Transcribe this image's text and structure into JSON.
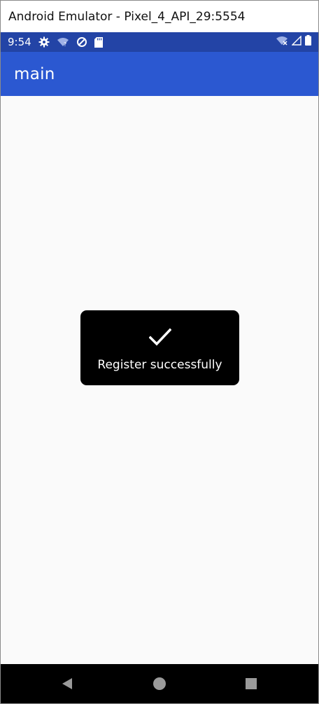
{
  "window": {
    "title": "Android Emulator - Pixel_4_API_29:5554"
  },
  "status_bar": {
    "time": "9:54",
    "left_icons": [
      "gear-icon",
      "wifi-question-icon",
      "data-saver-icon",
      "sd-card-icon"
    ],
    "right_icons": [
      "wifi-off-icon",
      "signal-icon",
      "battery-icon"
    ],
    "background": "#2344a6"
  },
  "app_bar": {
    "title": "main",
    "background": "#2b58d1"
  },
  "toast": {
    "icon": "checkmark-icon",
    "message": "Register successfully",
    "background": "#000000"
  },
  "nav_bar": {
    "buttons": [
      "back-icon",
      "home-icon",
      "recents-icon"
    ]
  }
}
